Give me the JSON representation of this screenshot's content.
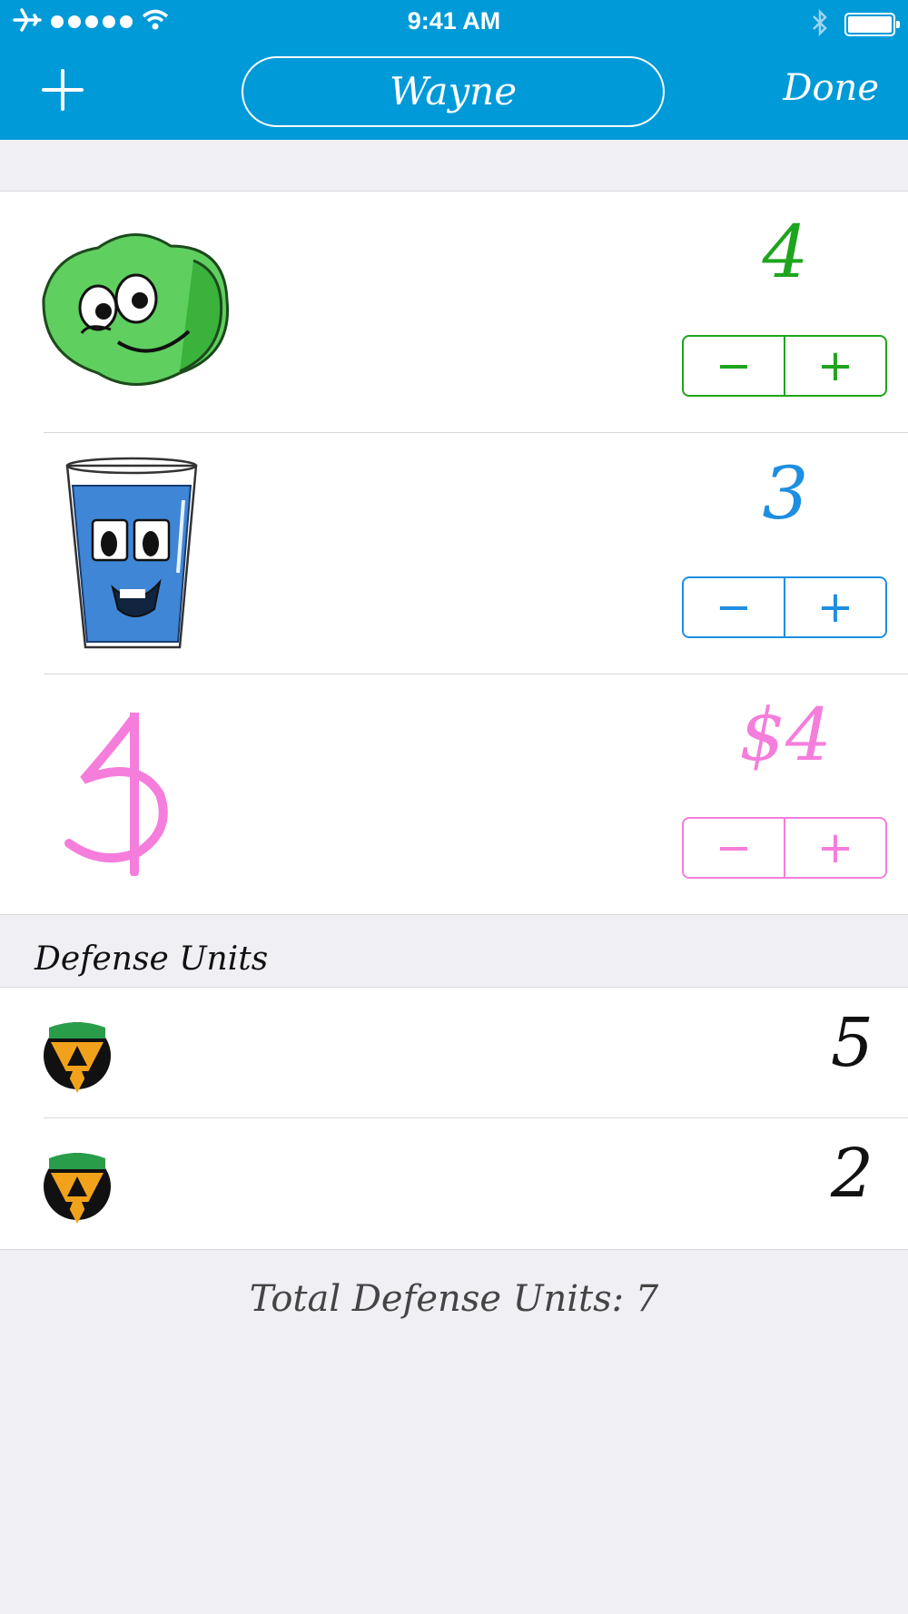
{
  "status_bar": {
    "time": "9:41 AM"
  },
  "nav": {
    "title": "Wayne",
    "done_label": "Done"
  },
  "resources": [
    {
      "name": "lettuce",
      "value": "4",
      "color": "#1ea51e",
      "minus": "−",
      "plus": "+"
    },
    {
      "name": "water",
      "value": "3",
      "color": "#1e8ee0",
      "minus": "−",
      "plus": "+"
    },
    {
      "name": "money",
      "value": "$4",
      "color": "#f57ddc",
      "minus": "−",
      "plus": "+"
    }
  ],
  "defense": {
    "header": "Defense Units",
    "units": [
      {
        "value": "5"
      },
      {
        "value": "2"
      }
    ],
    "total_label": "Total Defense Units: 7"
  }
}
